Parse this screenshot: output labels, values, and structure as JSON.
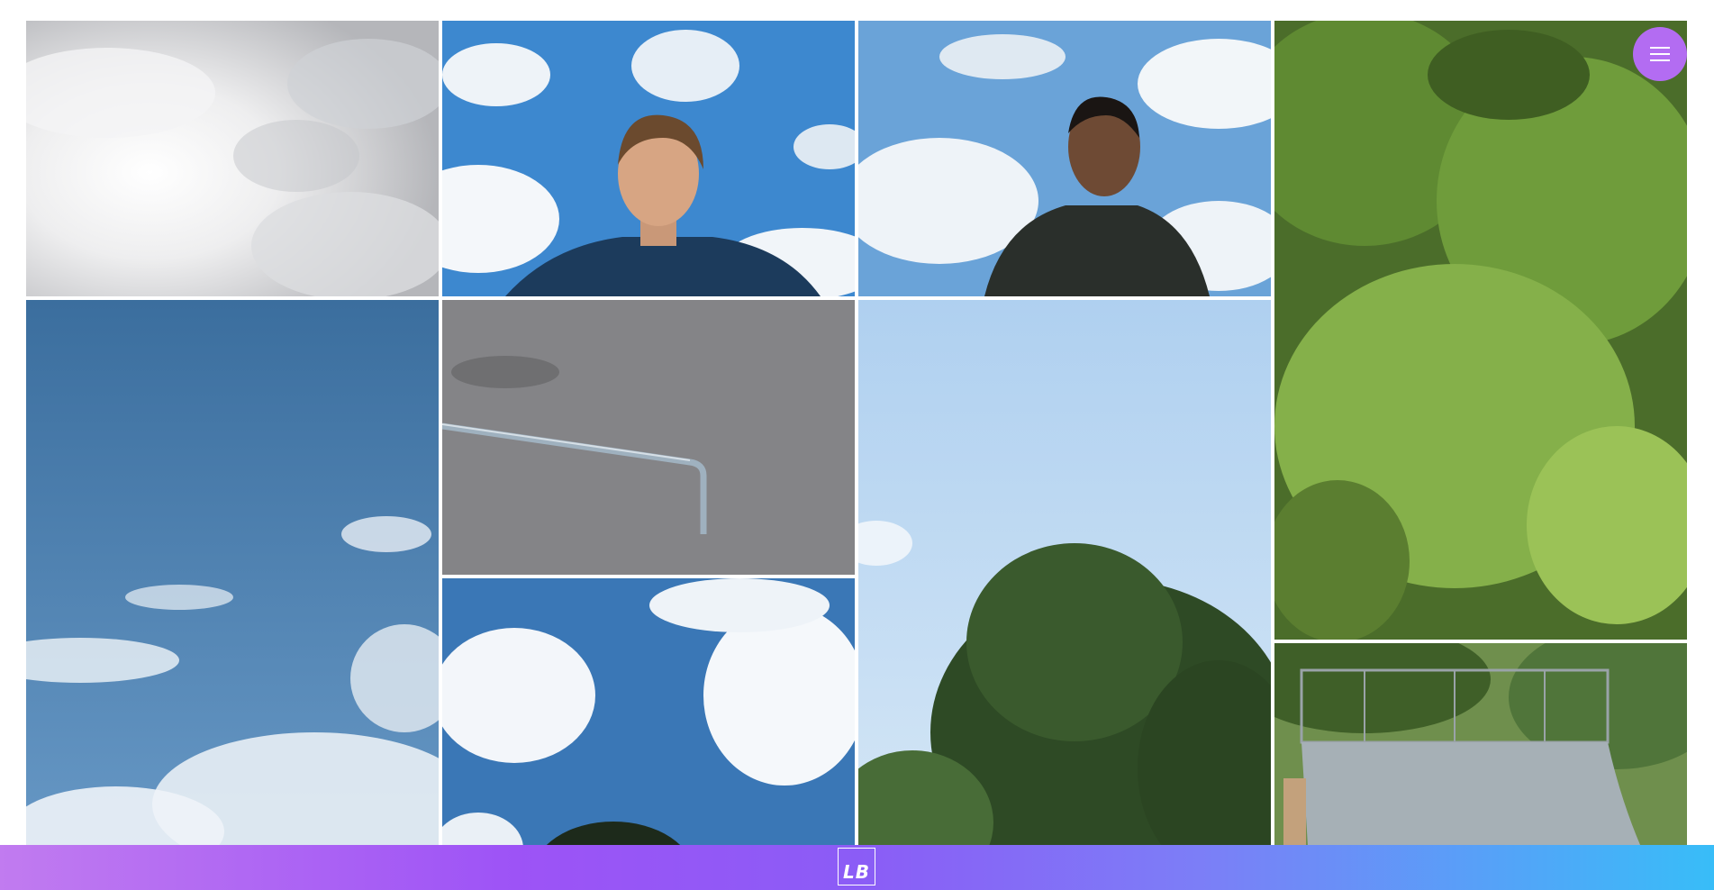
{
  "gallery": {
    "photos": [
      {
        "subject": "cloudy-sky-sun"
      },
      {
        "subject": "portrait-young-man-blue-shirt-sky"
      },
      {
        "subject": "portrait-young-man-green-shirt-sky"
      },
      {
        "subject": "tree-canopy-green"
      },
      {
        "subject": "blue-sky-wispy-clouds"
      },
      {
        "subject": "skate-rail-asphalt"
      },
      {
        "subject": "tree-under-clear-sky"
      },
      {
        "subject": "skate-halfpipe-ramp"
      },
      {
        "subject": "clouds-blue-sky-treetop"
      }
    ]
  },
  "menu": {
    "icon": "hamburger-menu-icon",
    "color": "#b36cf2"
  },
  "footer": {
    "logo_text": "LB",
    "gradient_colors": [
      "#c17bf0",
      "#9d53f6",
      "#8b5cf6",
      "#7c7ef7",
      "#38bdf8"
    ]
  }
}
